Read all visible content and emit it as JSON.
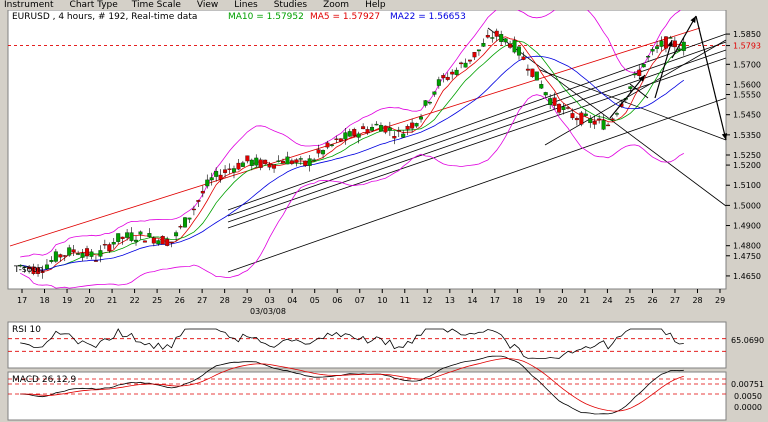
{
  "menu": [
    "Instrument",
    "Chart Type",
    "Time Scale",
    "View",
    "Lines",
    "Studies",
    "Zoom",
    "Help"
  ],
  "header": {
    "instrument": "EURUSD , 4 hours, # 192, Real-time data",
    "ma10": "MA10 = 1.57952",
    "ma5": "MA5 = 1.57927",
    "ma22": "MA22 = 1.56653"
  },
  "colors": {
    "ma10": "#00a000",
    "ma5": "#e00000",
    "ma22": "#0000e0",
    "up": "#00a000",
    "down": "#e00000",
    "bands": "#e000e0",
    "trendRed": "#e00000"
  },
  "price_axis": {
    "labels": [
      "1.5850",
      "1.5793",
      "1.5700",
      "1.5600",
      "1.5550",
      "1.5450",
      "1.5350",
      "1.5250",
      "1.5200",
      "1.5100",
      "1.5000",
      "1.4900",
      "1.4800",
      "1.4750",
      "1.4650"
    ],
    "current": "1.5793"
  },
  "time_axis": {
    "labels": [
      "17",
      "18",
      "19",
      "20",
      "21",
      "22",
      "25",
      "26",
      "27",
      "28",
      "29",
      "03",
      "04",
      "05",
      "06",
      "07",
      "10",
      "11",
      "12",
      "13",
      "14",
      "17",
      "18",
      "19",
      "20",
      "21",
      "24",
      "25",
      "26",
      "27",
      "28",
      "29"
    ],
    "date_label": "03/03/08"
  },
  "watermark": "T-soon",
  "rsi": {
    "title": "RSI 10",
    "level": "65.0690"
  },
  "macd": {
    "title": "MACD 26,12,9",
    "levels": [
      "0.00751",
      "0.0050",
      "0.0000"
    ]
  },
  "chart_data": {
    "type": "candlestick",
    "series": [
      {
        "name": "MA10",
        "value": 1.57952
      },
      {
        "name": "MA5",
        "value": 1.57927
      },
      {
        "name": "MA22",
        "value": 1.56653
      }
    ],
    "ylim": [
      1.46,
      1.59
    ],
    "x": [
      "17",
      "18",
      "19",
      "20",
      "21",
      "22",
      "25",
      "26",
      "27",
      "28",
      "29",
      "03",
      "04",
      "05",
      "06",
      "07",
      "10",
      "11",
      "12",
      "13",
      "14",
      "17",
      "18",
      "19",
      "20",
      "21",
      "24",
      "25",
      "26",
      "27",
      "28",
      "29"
    ],
    "close_path": [
      1.47,
      1.468,
      1.475,
      1.478,
      1.474,
      1.483,
      1.485,
      1.484,
      1.482,
      1.496,
      1.512,
      1.518,
      1.522,
      1.52,
      1.523,
      1.52,
      1.527,
      1.533,
      1.537,
      1.54,
      1.535,
      1.543,
      1.56,
      1.567,
      1.575,
      1.585,
      1.58,
      1.567,
      1.552,
      1.545,
      1.542,
      1.54,
      1.556,
      1.572,
      1.581,
      1.579
    ],
    "rsi_level": 65.069,
    "macd_levels": [
      0.00751,
      0.005,
      0.0
    ]
  }
}
